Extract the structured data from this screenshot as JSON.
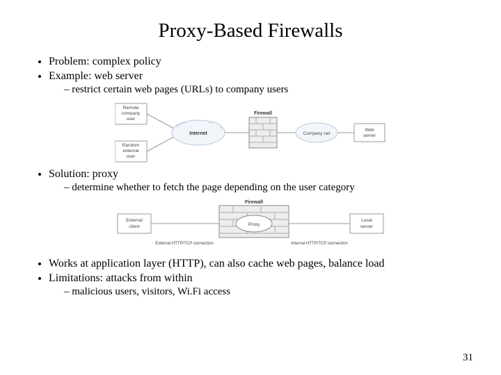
{
  "title": "Proxy-Based Firewalls",
  "bullets": {
    "problem": "Problem: complex policy",
    "example": "Example: web server",
    "example_sub": "restrict certain web pages (URLs) to company users",
    "solution": "Solution: proxy",
    "solution_sub": "determine whether to fetch the page depending on the user category",
    "works": "Works at application layer (HTTP), can also cache web pages, balance load",
    "limitations": "Limitations: attacks from within",
    "limitations_sub": "malicious users, visitors, Wi.Fi access"
  },
  "diagram1": {
    "remote_user": "Remote company user",
    "random_user": "Random external user",
    "internet": "Internet",
    "firewall": "Firewall",
    "company_net": "Company net",
    "web_server": "Web server"
  },
  "diagram2": {
    "external_client": "External client",
    "firewall": "Firewall",
    "proxy": "Proxy",
    "local_server": "Local server",
    "ext_conn": "External HTTP/TCP connection",
    "int_conn": "Internal HTTP/TCP connection"
  },
  "page_number": "31"
}
